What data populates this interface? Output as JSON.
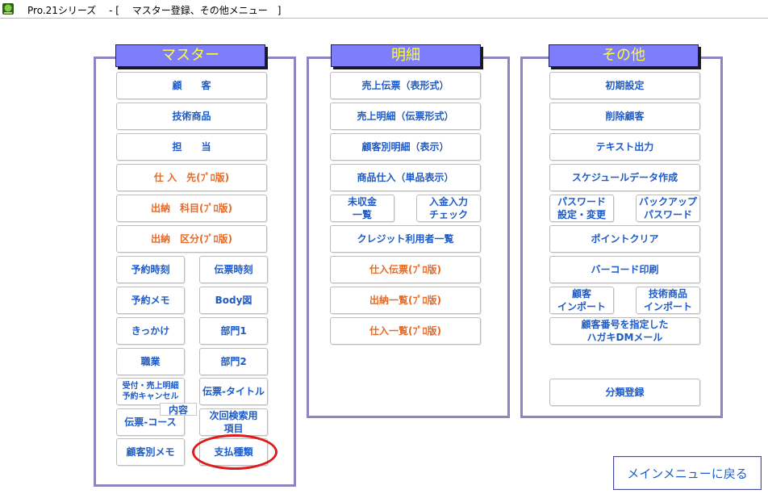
{
  "window": {
    "title": "Pro.21シリーズ　 - [　 マスター登録、その他メニュー　]"
  },
  "panels": {
    "master": {
      "title": "マスター"
    },
    "detail": {
      "title": "明細"
    },
    "other": {
      "title": "その他"
    }
  },
  "master": {
    "customer": "顧　　客",
    "tech_product": "技術商品",
    "staff": "担　　当",
    "supplier": "仕 入　先(ﾌﾟﾛ版)",
    "cash_item": "出納　科目(ﾌﾟﾛ版)",
    "cash_category": "出納　区分(ﾌﾟﾛ版)",
    "reserve_time": "予約時刻",
    "slip_time": "伝票時刻",
    "reserve_memo": "予約メモ",
    "body_chart": "Body図",
    "trigger": "きっかけ",
    "dept1": "部門1",
    "occupation": "職業",
    "dept2": "部門2",
    "reception_cancel": "受付・売上明細\n予約キャンセル",
    "contents_tag": "内容",
    "slip_title": "伝票-タイトル",
    "slip_course": "伝票-コース",
    "next_search": "次回検索用\n項目",
    "customer_memo": "顧客別メモ",
    "payment_type": "支払種類"
  },
  "detail": {
    "sales_slip_table": "売上伝票（表形式）",
    "sales_detail_slip": "売上明細（伝票形式）",
    "customer_detail": "顧客別明細（表示）",
    "product_purchase": "商品仕入（単品表示）",
    "unpaid_list": "未収金\n一覧",
    "deposit_check": "入金入力\nチェック",
    "credit_users": "クレジット利用者一覧",
    "purchase_slip": "仕入伝票(ﾌﾟﾛ版)",
    "cash_list": "出納一覧(ﾌﾟﾛ版)",
    "purchase_list": "仕入一覧(ﾌﾟﾛ版)"
  },
  "other": {
    "initial_settings": "初期設定",
    "delete_customer": "削除顧客",
    "text_output": "テキスト出力",
    "schedule_data": "スケジュールデータ作成",
    "password_settings": "パスワード\n設定・変更",
    "backup_password": "バックアップ\nパスワード",
    "point_clear": "ポイントクリア",
    "barcode_print": "バーコード印刷",
    "customer_import": "顧客\nインポート",
    "tech_import": "技術商品\nインポート",
    "postcard_dm": "顧客番号を指定した\nハガキDMメール",
    "classification": "分類登録"
  },
  "footer": {
    "return_main": "メインメニューに戻る"
  },
  "colors": {
    "header_bg": "#7e7efc",
    "header_text": "#ffff33",
    "button_text": "#1f5bc6",
    "pro_text": "#e36b2a",
    "panel_border": "#8c86c0",
    "highlight": "#e01a1a"
  }
}
